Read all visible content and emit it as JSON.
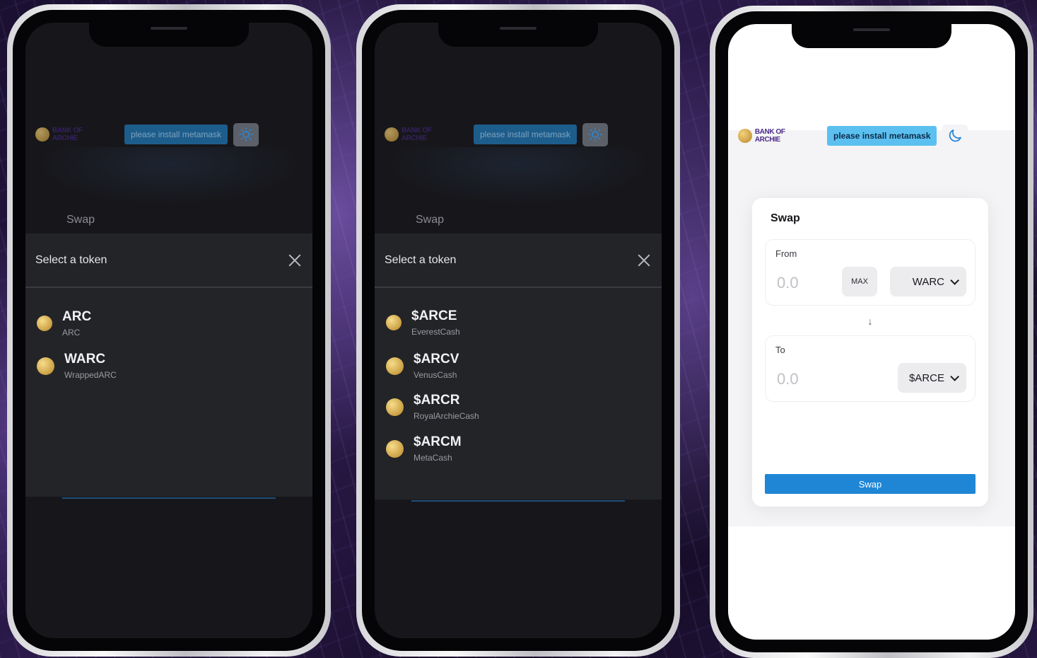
{
  "header": {
    "logo_text": "BANK OF ARCHIE",
    "metamask_label": "please install metamask"
  },
  "phone1": {
    "swap_title": "Swap",
    "modal_title": "Select a token",
    "tokens": [
      {
        "symbol": "ARC",
        "name": "ARC"
      },
      {
        "symbol": "WARC",
        "name": "WrappedARC"
      }
    ]
  },
  "phone2": {
    "swap_title": "Swap",
    "modal_title": "Select a token",
    "tokens": [
      {
        "symbol": "$ARCE",
        "name": "EverestCash"
      },
      {
        "symbol": "$ARCV",
        "name": "VenusCash"
      },
      {
        "symbol": "$ARCR",
        "name": "RoyalArchieCash"
      },
      {
        "symbol": "$ARCM",
        "name": "MetaCash"
      }
    ]
  },
  "phone3": {
    "card_title": "Swap",
    "from_label": "From",
    "from_value": "0.0",
    "max_label": "MAX",
    "from_token": "WARC",
    "to_label": "To",
    "to_value": "0.0",
    "to_token": "$ARCE",
    "swap_button": "Swap"
  },
  "colors": {
    "accent_blue": "#1f86d6",
    "metamask_light": "#5bc0f0",
    "dark_bg": "#17171b",
    "coin_gold": "#d8a848"
  }
}
